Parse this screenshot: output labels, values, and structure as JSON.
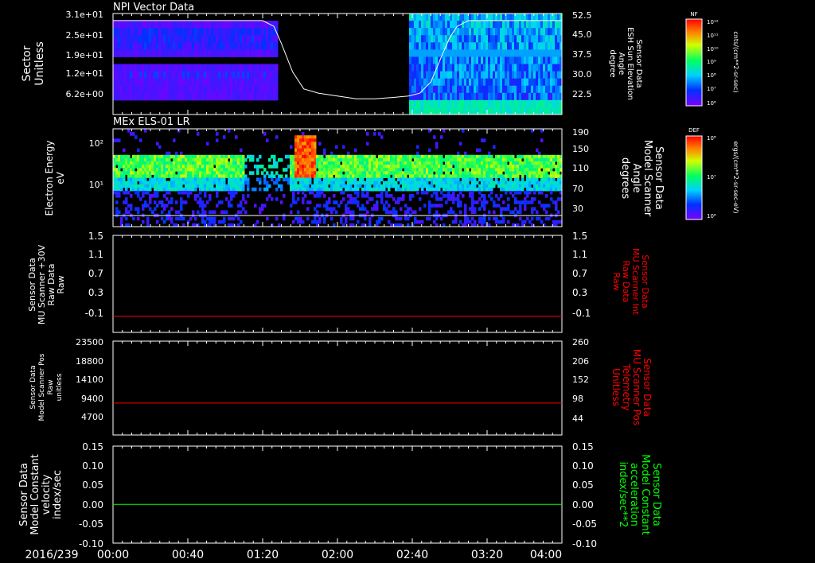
{
  "figure": {
    "background": "#000000",
    "date_label": "2016/239"
  },
  "x_axis": {
    "tick_labels": [
      "00:00",
      "00:40",
      "01:20",
      "02:00",
      "02:40",
      "03:20",
      "04:00"
    ],
    "range_minutes": [
      0,
      240
    ],
    "major_step_minutes": 40,
    "minor_step_minutes": 5
  },
  "colorbars": [
    {
      "title": "NF",
      "ticks": [
        "10¹²",
        "10¹¹",
        "10¹⁰",
        "10⁹",
        "10⁸",
        "10⁷",
        "10⁶"
      ],
      "unit": "cnts/(cm**2-sr-sec)"
    },
    {
      "title": "DEF",
      "ticks": [
        "10⁸",
        "10⁷",
        "10⁶"
      ],
      "unit": "ergs/(cm**2-sr-sec-eV)"
    }
  ],
  "panels": [
    {
      "title": "NPI Vector Data",
      "left_label": [
        "Sector",
        "Unitless"
      ],
      "left_ticks": [
        "3.1e+01",
        "2.5e+01",
        "1.9e+01",
        "1.2e+01",
        "6.2e+00"
      ],
      "right_label": [
        "Sensor Data",
        "ESH Sun Elevation",
        "Angle",
        "degree"
      ],
      "right_ticks": [
        "52.5",
        "45.0",
        "37.5",
        "30.0",
        "22.5"
      ]
    },
    {
      "title": "MEx ELS-01 LR",
      "left_label": [
        "Electron Energy",
        "eV"
      ],
      "left_ticks": [
        "10²",
        "10¹"
      ],
      "right_label": [
        "Sensor Data",
        "Model Scanner",
        "Angle",
        "degrees"
      ],
      "right_ticks": [
        "190",
        "150",
        "110",
        "70",
        "30"
      ]
    },
    {
      "title": "",
      "left_label": [
        "Sensor Data",
        "MU Scanner +30V",
        "Raw Data",
        "Raw"
      ],
      "left_ticks": [
        "1.5",
        "1.1",
        "0.7",
        "0.3",
        "-0.1"
      ],
      "right_label": [
        "Sensor Data",
        "MU Scanner Int",
        "Raw Data",
        "Raw"
      ],
      "right_ticks": [
        "1.5",
        "1.1",
        "0.7",
        "0.3",
        "-0.1"
      ]
    },
    {
      "title": "",
      "left_label": [
        "Sensor Data",
        "Model Scanner Pos",
        "Raw",
        "unitless"
      ],
      "left_ticks": [
        "23500",
        "18800",
        "14100",
        "9400",
        "4700"
      ],
      "right_label": [
        "Sensor Data",
        "MU Scanner Pos",
        "Telemetry",
        "Unitless"
      ],
      "right_ticks": [
        "260",
        "206",
        "152",
        "98",
        "44"
      ]
    },
    {
      "title": "",
      "left_label": [
        "Sensor Data",
        "Model Constant",
        "velocity",
        "index/sec"
      ],
      "left_ticks": [
        "0.15",
        "0.10",
        "0.05",
        "0.00",
        "-0.05",
        "-0.10"
      ],
      "right_label": [
        "Sensor Data",
        "Model Constant",
        "acceleration",
        "index/sec**2"
      ],
      "right_ticks": [
        "0.15",
        "0.10",
        "0.05",
        "0.00",
        "-0.05",
        "-0.10"
      ]
    }
  ],
  "chart_data": [
    {
      "type": "heatmap",
      "title": "NPI Vector Data",
      "ylabel": "Sector Unitless",
      "y2label": "Sensor Data ESH Sun Elevation Angle degree",
      "y_ticks": [
        "3.1e+01",
        "2.5e+01",
        "1.9e+01",
        "1.2e+01",
        "6.2e+00"
      ],
      "y2_ticks": [
        "52.5",
        "45.0",
        "37.5",
        "30.0",
        "22.5"
      ],
      "data_gap_minutes": [
        [
          88,
          158
        ]
      ],
      "overlay_series": {
        "name": "Sensor Data ESH Sun Elevation Angle",
        "color": "#ffffff",
        "x_minutes": [
          0,
          80,
          86,
          90,
          96,
          102,
          110,
          120,
          130,
          140,
          150,
          158,
          164,
          170,
          176,
          180,
          184,
          190,
          200,
          210,
          220,
          240
        ],
        "y": [
          50,
          50,
          48,
          42,
          32,
          26,
          24.5,
          23.5,
          22.5,
          22.5,
          23,
          23.5,
          24.5,
          28.5,
          38,
          44,
          48,
          50,
          50,
          50,
          50,
          50
        ],
        "y_range": [
          17,
          52.5
        ]
      }
    },
    {
      "type": "heatmap",
      "title": "MEx ELS-01 LR",
      "ylabel": "Electron Energy eV",
      "y2label": "Sensor Data Model Scanner Angle degrees",
      "y_ticks": [
        "10²",
        "10¹"
      ],
      "y2_ticks": [
        "190",
        "150",
        "110",
        "70",
        "30"
      ],
      "y_log_range": [
        0.2,
        2.1
      ],
      "features": [
        {
          "x_minutes": [
            0,
            240
          ],
          "log_energy": [
            1.1,
            1.5
          ],
          "level": "high",
          "description_color": "green-yellow"
        },
        {
          "x_minutes": [
            96,
            108
          ],
          "log_energy": [
            1.2,
            2.1
          ],
          "level": "peak",
          "description_color": "red"
        }
      ],
      "overlay_series": {
        "name": "Sensor Data Model Scanner Angle",
        "color": "#ffffff",
        "x_minutes": [
          0,
          240
        ],
        "y": [
          12,
          12
        ],
        "y_range": [
          0,
          190
        ]
      }
    },
    {
      "type": "line",
      "ylabel": "Sensor Data MU Scanner +30V Raw Data Raw",
      "y2label": "Sensor Data MU Scanner Int Raw Data Raw",
      "ylim": [
        -0.3,
        1.5
      ],
      "series": [
        {
          "name": "Sensor Data MU Scanner Int Raw Data",
          "color": "#ff0000",
          "x_minutes": [
            0,
            240
          ],
          "values": [
            0.0,
            0.0
          ]
        }
      ]
    },
    {
      "type": "line",
      "ylabel": "Sensor Data Model Scanner Pos Raw unitless",
      "y2label": "Sensor Data MU Scanner Pos Telemetry Unitless",
      "ylim": [
        0,
        23500
      ],
      "y2lim": [
        0,
        260
      ],
      "series": [
        {
          "name": "Sensor Data MU Scanner Pos Telemetry",
          "color": "#ff0000",
          "x_minutes": [
            0,
            240
          ],
          "values": [
            8000,
            8000
          ]
        }
      ]
    },
    {
      "type": "line",
      "ylabel": "Sensor Data Model Constant velocity index/sec",
      "y2label": "Sensor Data Model Constant acceleration index/sec**2",
      "ylim": [
        -0.1,
        0.15
      ],
      "series": [
        {
          "name": "Sensor Data Model Constant acceleration",
          "color": "#00ff00",
          "x_minutes": [
            0,
            240
          ],
          "values": [
            0.0,
            0.0
          ]
        }
      ]
    }
  ]
}
